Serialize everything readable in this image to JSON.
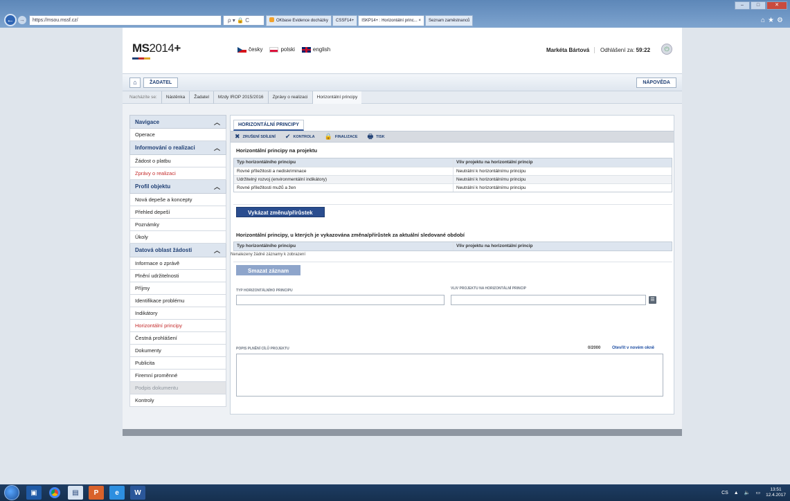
{
  "browser": {
    "url": "https://msou.mssf.cz/",
    "search_hint": "ρ ▾ 🔒 C",
    "tabs": [
      {
        "label": "OKbase Evidence docházky",
        "active": false
      },
      {
        "label": "CSSF14+",
        "active": false
      },
      {
        "label": "ISKP14+ : Horizontální princ... ×",
        "active": true
      },
      {
        "label": "Seznam zaměstnanců",
        "active": false
      }
    ]
  },
  "header": {
    "logo_main": "MS",
    "logo_rest": "2014",
    "logo_plus": "+",
    "languages": [
      "česky",
      "polski",
      "english"
    ],
    "user_name": "Markéta Bártová",
    "logout_label": "Odhlášení za:",
    "logout_time": "59:22"
  },
  "role_bar": {
    "role": "ŽADATEL",
    "help": "NÁPOVĚDA"
  },
  "breadcrumb": {
    "lead": "Nacházíte se:",
    "items": [
      "Nástěnka",
      "Žadatel",
      "Mzdy IROP 2015/2016",
      "Zprávy o realizaci",
      "Horizontální principy"
    ]
  },
  "sidebar": {
    "sections": [
      {
        "title": "Navigace",
        "items": [
          {
            "label": "Operace",
            "state": "normal"
          }
        ]
      },
      {
        "title": "Informování o realizaci",
        "items": [
          {
            "label": "Žádost o platbu",
            "state": "normal"
          },
          {
            "label": "Zprávy o realizaci",
            "state": "active"
          }
        ]
      },
      {
        "title": "Profil objektu",
        "items": [
          {
            "label": "Nová depeše a koncepty",
            "state": "normal"
          },
          {
            "label": "Přehled depeší",
            "state": "normal"
          },
          {
            "label": "Poznámky",
            "state": "normal"
          },
          {
            "label": "Úkoly",
            "state": "normal"
          }
        ]
      },
      {
        "title": "Datová oblast žádosti",
        "items": [
          {
            "label": "Informace o zprávě",
            "state": "normal"
          },
          {
            "label": "Plnění udržitelnosti",
            "state": "normal"
          },
          {
            "label": "Příjmy",
            "state": "normal"
          },
          {
            "label": "Identifikace problému",
            "state": "normal"
          },
          {
            "label": "Indikátory",
            "state": "normal"
          },
          {
            "label": "Horizontální principy",
            "state": "active"
          },
          {
            "label": "Čestná prohlášení",
            "state": "normal"
          },
          {
            "label": "Dokumenty",
            "state": "normal"
          },
          {
            "label": "Publicita",
            "state": "normal"
          },
          {
            "label": "Firemní proměnné",
            "state": "normal"
          },
          {
            "label": "Podpis dokumentu",
            "state": "disabled"
          },
          {
            "label": "Kontroly",
            "state": "normal"
          }
        ]
      }
    ]
  },
  "main": {
    "tab": "HORIZONTÁLNÍ PRINCIPY",
    "toolbar": [
      {
        "label": "ZRUŠENÍ SDÍLENÍ",
        "icon": "close-x-icon",
        "glyph": "✖"
      },
      {
        "label": "KONTROLA",
        "icon": "checkmark-icon",
        "glyph": "✔"
      },
      {
        "label": "FINALIZACE",
        "icon": "lock-icon",
        "glyph": "🔒"
      },
      {
        "label": "TISK",
        "icon": "printer-icon",
        "glyph": "🖶"
      }
    ],
    "section1_title": "Horizontální principy na projektu",
    "table1": {
      "headers": [
        "Typ horizontálního principu",
        "Vliv projektu na horizontální princip"
      ],
      "rows": [
        [
          "Rovné příležitosti a nediskriminace",
          "Neutrální k horizontálnímu principu"
        ],
        [
          "Udržitelný rozvoj (environmentální indikátory)",
          "Neutrální k horizontálnímu principu"
        ],
        [
          "Rovné příležitosti mužů a žen",
          "Neutrální k horizontálnímu principu"
        ]
      ]
    },
    "change_button": "Vykázat změnu/přírůstek",
    "section2_title": "Horizontální principy, u kterých je vykazována změna/přírůstek za aktuální sledované období",
    "table2": {
      "headers": [
        "Typ horizontálního principu",
        "Vliv projektu na horizontální princip"
      ],
      "empty_note": "Nenalezeny žádné záznamy k zobrazení"
    },
    "delete_button": "Smazat záznam",
    "field_type_label": "TYP HORIZONTÁLNÍHO PRINCIPU",
    "field_influence_label": "VLIV PROJEKTU NA HORIZONTÁLNÍ PRINCIP",
    "description_label": "POPIS PLNĚNÍ CÍLŮ PROJEKTU",
    "counter": "0/2000",
    "open_new_window": "Otevřít v novém okně"
  },
  "taskbar": {
    "lang": "CS",
    "time": "13:51",
    "date": "12.4.2017"
  },
  "colors": {
    "accent": "#2a4d8f",
    "active_nav": "#c42b2b"
  }
}
